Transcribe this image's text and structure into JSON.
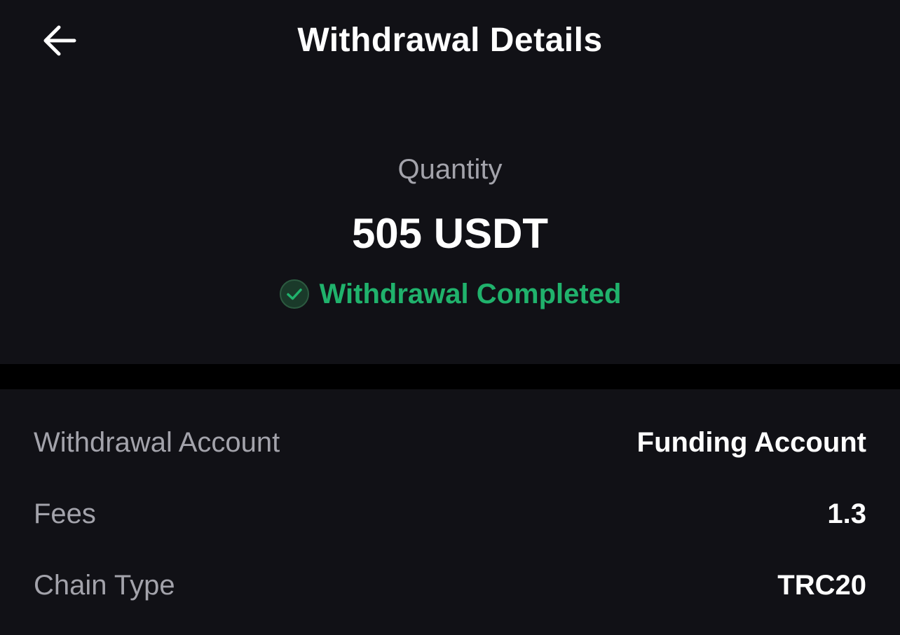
{
  "header": {
    "title": "Withdrawal Details",
    "back_icon": "arrow-left-icon"
  },
  "summary": {
    "quantity_label": "Quantity",
    "quantity_value": "505 USDT",
    "status_text": "Withdrawal Completed",
    "status_icon": "check-circle-icon",
    "status_color": "#20b26c"
  },
  "details": [
    {
      "label": "Withdrawal Account",
      "value": "Funding Account"
    },
    {
      "label": "Fees",
      "value": "1.3"
    },
    {
      "label": "Chain Type",
      "value": "TRC20"
    }
  ],
  "colors": {
    "background": "#111116",
    "divider": "#000000",
    "primary_text": "#ffffff",
    "secondary_text": "#a3a3ab",
    "success": "#20b26c"
  }
}
